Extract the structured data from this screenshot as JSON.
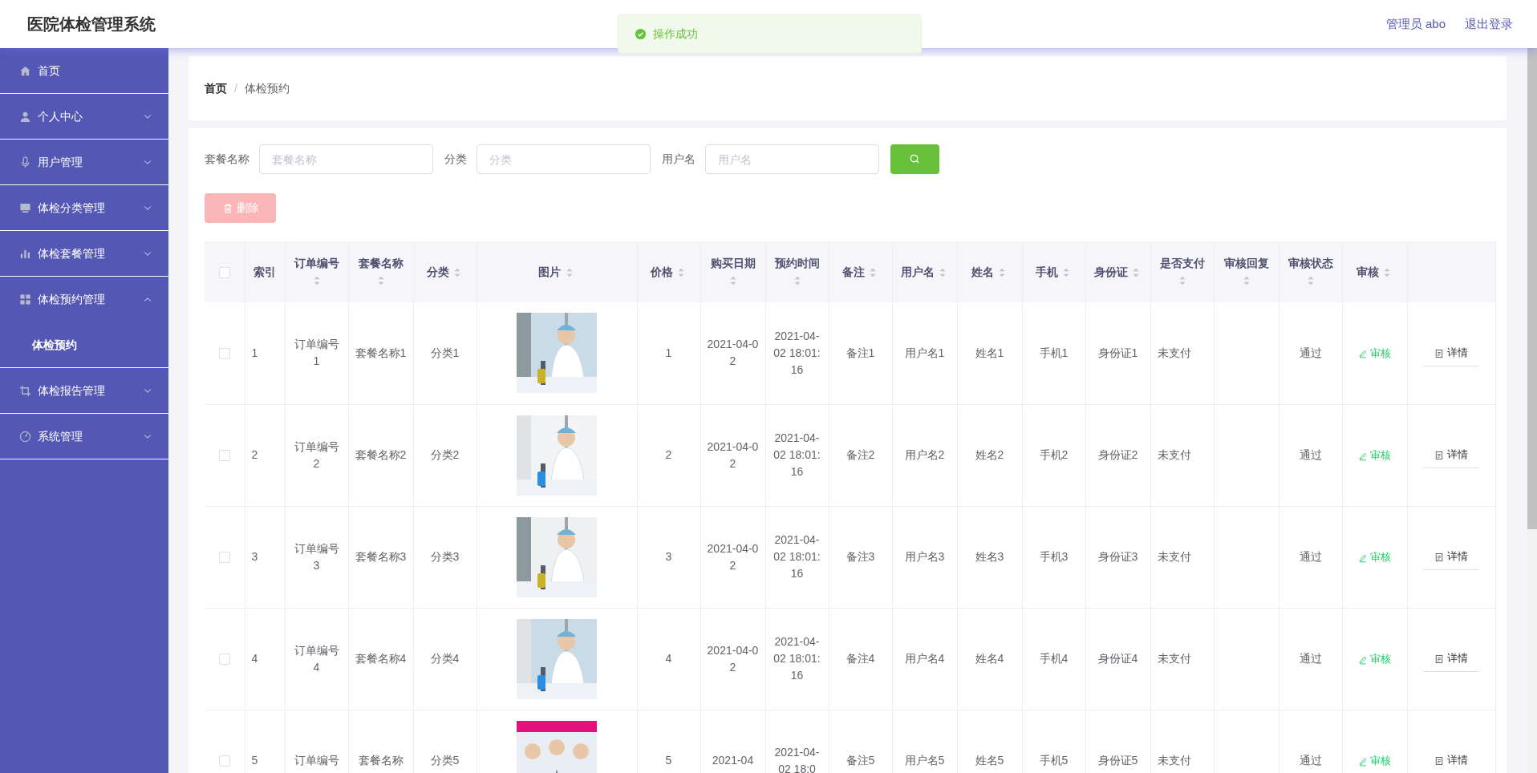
{
  "app_title": "医院体检管理系统",
  "header": {
    "user": "管理员 abo",
    "logout": "退出登录"
  },
  "toast": {
    "kind": "success",
    "message": "操作成功"
  },
  "sidebar": {
    "items": [
      {
        "label": "首页",
        "kind": "link",
        "expanded": false
      },
      {
        "label": "个人中心",
        "kind": "menu",
        "expanded": false
      },
      {
        "label": "用户管理",
        "kind": "menu",
        "expanded": false
      },
      {
        "label": "体检分类管理",
        "kind": "menu",
        "expanded": false
      },
      {
        "label": "体检套餐管理",
        "kind": "menu",
        "expanded": false
      },
      {
        "label": "体检预约管理",
        "kind": "menu",
        "expanded": true,
        "children": [
          {
            "label": "体检预约",
            "selected": true
          }
        ]
      },
      {
        "label": "体检报告管理",
        "kind": "menu",
        "expanded": false
      },
      {
        "label": "系统管理",
        "kind": "menu",
        "expanded": false
      }
    ]
  },
  "breadcrumb": {
    "separator": "/",
    "items": [
      "首页",
      "体检预约"
    ]
  },
  "filters": [
    {
      "label": "套餐名称",
      "placeholder": "套餐名称"
    },
    {
      "label": "分类",
      "placeholder": "分类"
    },
    {
      "label": "用户名",
      "placeholder": "用户名"
    }
  ],
  "delete_button": {
    "label": "删除",
    "disabled": true
  },
  "table": {
    "header_checked": false,
    "columns": [
      {
        "label": "索引",
        "sortable": false
      },
      {
        "label": "订单编号",
        "sortable": true
      },
      {
        "label": "套餐名称",
        "sortable": true
      },
      {
        "label": "分类",
        "sortable": true
      },
      {
        "label": "图片",
        "sortable": true
      },
      {
        "label": "价格",
        "sortable": true
      },
      {
        "label": "购买日期",
        "sortable": true
      },
      {
        "label": "预约时间",
        "sortable": true
      },
      {
        "label": "备注",
        "sortable": true
      },
      {
        "label": "用户名",
        "sortable": true
      },
      {
        "label": "姓名",
        "sortable": true
      },
      {
        "label": "手机",
        "sortable": true
      },
      {
        "label": "身份证",
        "sortable": true
      },
      {
        "label": "是否支付",
        "sortable": true
      },
      {
        "label": "审核回复",
        "sortable": true
      },
      {
        "label": "审核状态",
        "sortable": true
      },
      {
        "label": "审核",
        "sortable": true
      }
    ],
    "rows": [
      {
        "checked": false,
        "index": "1",
        "order_no": "订单编号1",
        "package": "套餐名称1",
        "category": "分类1",
        "price": "1",
        "purchase_date": "2021-04-02",
        "appointment_time": "2021-04-02 18:01:16",
        "note": "备注1",
        "username": "用户名1",
        "name": "姓名1",
        "phone": "手机1",
        "id_card": "身份证1",
        "paid": "未支付",
        "status": "通过",
        "review": "审核",
        "detail": "详情"
      },
      {
        "checked": false,
        "index": "2",
        "order_no": "订单编号2",
        "package": "套餐名称2",
        "category": "分类2",
        "price": "2",
        "purchase_date": "2021-04-02",
        "appointment_time": "2021-04-02 18:01:16",
        "note": "备注2",
        "username": "用户名2",
        "name": "姓名2",
        "phone": "手机2",
        "id_card": "身份证2",
        "paid": "未支付",
        "status": "通过",
        "review": "审核",
        "detail": "详情"
      },
      {
        "checked": false,
        "index": "3",
        "order_no": "订单编号3",
        "package": "套餐名称3",
        "category": "分类3",
        "price": "3",
        "purchase_date": "2021-04-02",
        "appointment_time": "2021-04-02 18:01:16",
        "note": "备注3",
        "username": "用户名3",
        "name": "姓名3",
        "phone": "手机3",
        "id_card": "身份证3",
        "paid": "未支付",
        "status": "通过",
        "review": "审核",
        "detail": "详情"
      },
      {
        "checked": false,
        "index": "4",
        "order_no": "订单编号4",
        "package": "套餐名称4",
        "category": "分类4",
        "price": "4",
        "purchase_date": "2021-04-02",
        "appointment_time": "2021-04-02 18:01:16",
        "note": "备注4",
        "username": "用户名4",
        "name": "姓名4",
        "phone": "手机4",
        "id_card": "身份证4",
        "paid": "未支付",
        "status": "通过",
        "review": "审核",
        "detail": "详情"
      },
      {
        "checked": false,
        "index": "5",
        "order_no": "订单编号",
        "package": "套餐名称",
        "category": "分类5",
        "price": "5",
        "purchase_date": "2021-04",
        "appointment_time": "2021-04-02 18:0",
        "note": "备注5",
        "username": "用户名5",
        "name": "姓名5",
        "phone": "手机5",
        "id_card": "身份证5",
        "paid": "未支付",
        "status": "通过",
        "review": "审核",
        "detail": "详情"
      }
    ]
  }
}
